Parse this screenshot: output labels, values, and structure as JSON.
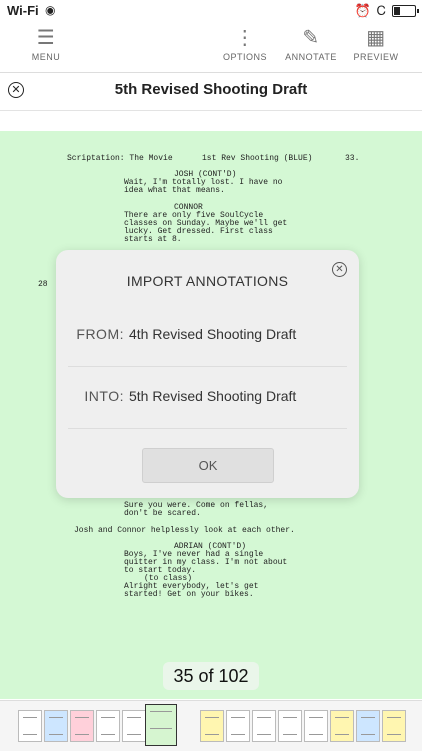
{
  "status": {
    "carrier": "Wi-Fi"
  },
  "toolbar": {
    "menu": "MENU",
    "options": "OPTIONS",
    "annotate": "ANNOTATE",
    "preview": "PREVIEW"
  },
  "title": "5th Revised Shooting Draft",
  "script": {
    "header_left": "Scriptation: The Movie",
    "header_mid": "1st Rev Shooting (BLUE)",
    "page_num": "33.",
    "scene_num": "28",
    "lines": [
      "JOSH (CONT'D)",
      "Wait, I'm totally lost. I have no",
      "idea what that means.",
      "CONNOR",
      "There are only five SoulCycle",
      "classes on Sunday. Maybe we'll get",
      "lucky. Get dressed. First class",
      "starts at 8.",
      "Sure you were. Come on fellas,",
      "don't be scared.",
      "Josh and Connor helplessly look at each other.",
      "ADRIAN (CONT'D)",
      "Boys, I've never had a single",
      "quitter in my class. I'm not about",
      "to start today.",
      "(to class)",
      "Alright everybody, let's get",
      "started! Get on your bikes."
    ]
  },
  "counter": "35 of 102",
  "modal": {
    "title": "IMPORT ANNOTATIONS",
    "from_label": "FROM:",
    "from_value": "4th Revised Shooting Draft",
    "into_label": "INTO:",
    "into_value": "5th Revised Shooting Draft",
    "ok": "OK"
  },
  "thumb_colors": [
    "#ffffff",
    "#cde6ff",
    "#ffd0da",
    "#ffffff",
    "#ffffff",
    "#d6f5d0",
    "#fff6b0",
    "#ffffff",
    "#ffffff",
    "#ffffff",
    "#ffffff",
    "#fff6b0",
    "#cde6ff",
    "#fff6b0"
  ]
}
